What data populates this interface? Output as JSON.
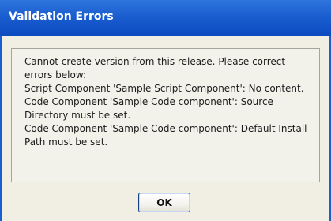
{
  "dialog": {
    "title": "Validation Errors",
    "messages": [
      "Cannot create version from this release. Please correct errors below:",
      "Script Component 'Sample Script Component': No content.",
      "Code Component 'Sample Code component': Source Directory must be set.",
      "Code Component 'Sample Code component': Default Install Path must be set."
    ],
    "ok_label": "OK"
  },
  "colors": {
    "title_bar": "#1a5ed0",
    "frame_background": "#f1efe3",
    "title_text": "#ffffff"
  }
}
